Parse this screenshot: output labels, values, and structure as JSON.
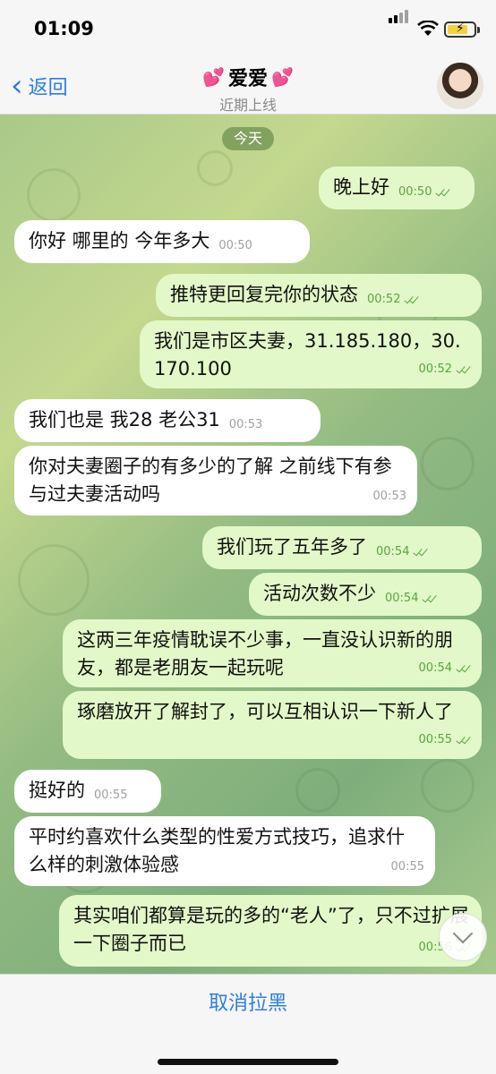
{
  "status_bar": {
    "time": "01:09"
  },
  "header": {
    "back_label": "返回",
    "back_icon": "chevron-left-icon",
    "title": "爱爱",
    "title_emoji": "💕",
    "subtitle": "近期上线"
  },
  "chat": {
    "date_label": "今天",
    "messages": [
      {
        "dir": "out",
        "text": "晚上好",
        "time": "00:50"
      },
      {
        "dir": "in",
        "text": "你好 哪里的 今年多大",
        "time": "00:50"
      },
      {
        "dir": "out",
        "text": "推特更回复完你的状态",
        "time": "00:52"
      },
      {
        "dir": "out",
        "text": "我们是市区夫妻，31.185.180，30.170.100",
        "time": "00:52"
      },
      {
        "dir": "in",
        "text": "我们也是 我28 老公31",
        "time": "00:53"
      },
      {
        "dir": "in",
        "text": "你对夫妻圈子的有多少的了解 之前线下有参与过夫妻活动吗",
        "time": "00:53"
      },
      {
        "dir": "out",
        "text": "我们玩了五年多了",
        "time": "00:54"
      },
      {
        "dir": "out",
        "text": "活动次数不少",
        "time": "00:54"
      },
      {
        "dir": "out",
        "text": "这两三年疫情耽误不少事，一直没认识新的朋友，都是老朋友一起玩呢",
        "time": "00:54"
      },
      {
        "dir": "out",
        "text": "琢磨放开了解封了，可以互相认识一下新人了",
        "time": "00:55"
      },
      {
        "dir": "in",
        "text": "挺好的",
        "time": "00:55"
      },
      {
        "dir": "in",
        "text": "平时约喜欢什么类型的性爱方式技巧，追求什么样的刺激体验感",
        "time": "00:55"
      },
      {
        "dir": "out",
        "text": "其实咱们都算是玩的多的“老人”了，只不过扩展一下圈子而已",
        "time": "00:56"
      }
    ]
  },
  "bottom": {
    "unblock_label": "取消拉黑"
  },
  "colors": {
    "accent": "#2f7de1",
    "outgoing_bubble": "#e2f8c8",
    "incoming_bubble": "#ffffff",
    "read_ticks": "#5aa53f"
  }
}
